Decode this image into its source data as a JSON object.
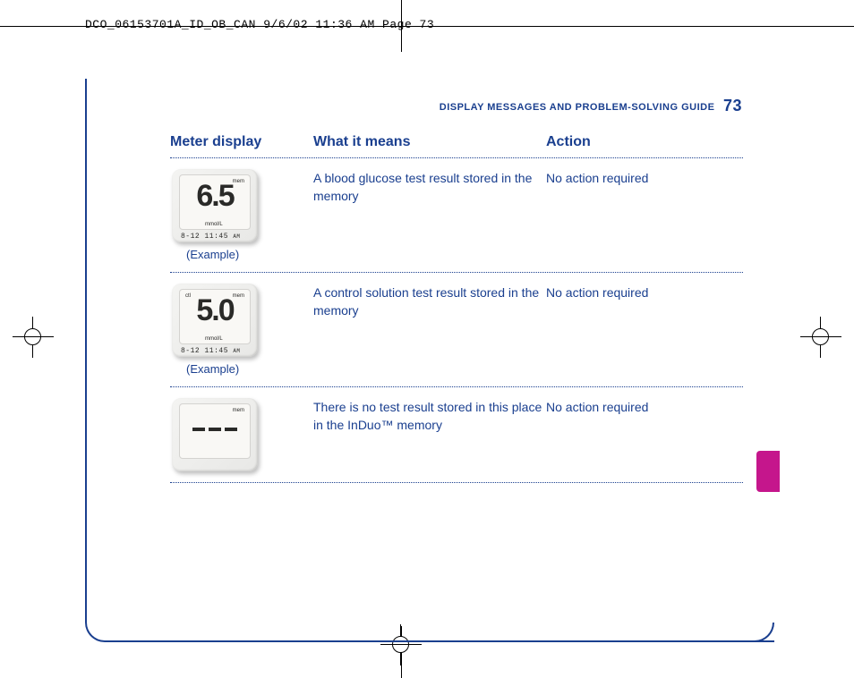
{
  "slug": "DCO_06153701A_ID_OB_CAN  9/6/02  11:36 AM  Page 73",
  "header": {
    "running_head": "DISPLAY MESSAGES AND PROBLEM-SOLVING GUIDE",
    "page_number": "73"
  },
  "columns": {
    "c1": "Meter display",
    "c2": "What it means",
    "c3": "Action"
  },
  "rows": [
    {
      "display": {
        "value": "6.5",
        "mem": "mem",
        "ctl": "",
        "unit": "mmol/L",
        "datetime": "8-12  11:45",
        "ampm": "AM",
        "caption": "(Example)"
      },
      "meaning": "A blood glucose test result stored in the memory",
      "action": "No action required"
    },
    {
      "display": {
        "value": "5.0",
        "mem": "mem",
        "ctl": "ctl",
        "unit": "mmol/L",
        "datetime": "8-12  11:45",
        "ampm": "AM",
        "caption": "(Example)"
      },
      "meaning": "A control solution test result stored in the memory",
      "action": "No action required"
    },
    {
      "display": {
        "value": "",
        "mem": "mem",
        "ctl": "",
        "unit": "",
        "datetime": "",
        "ampm": "",
        "caption": "",
        "dashes": true
      },
      "meaning": "There is no test result stored in this place in the InDuo™ memory",
      "action": "No action required"
    }
  ]
}
